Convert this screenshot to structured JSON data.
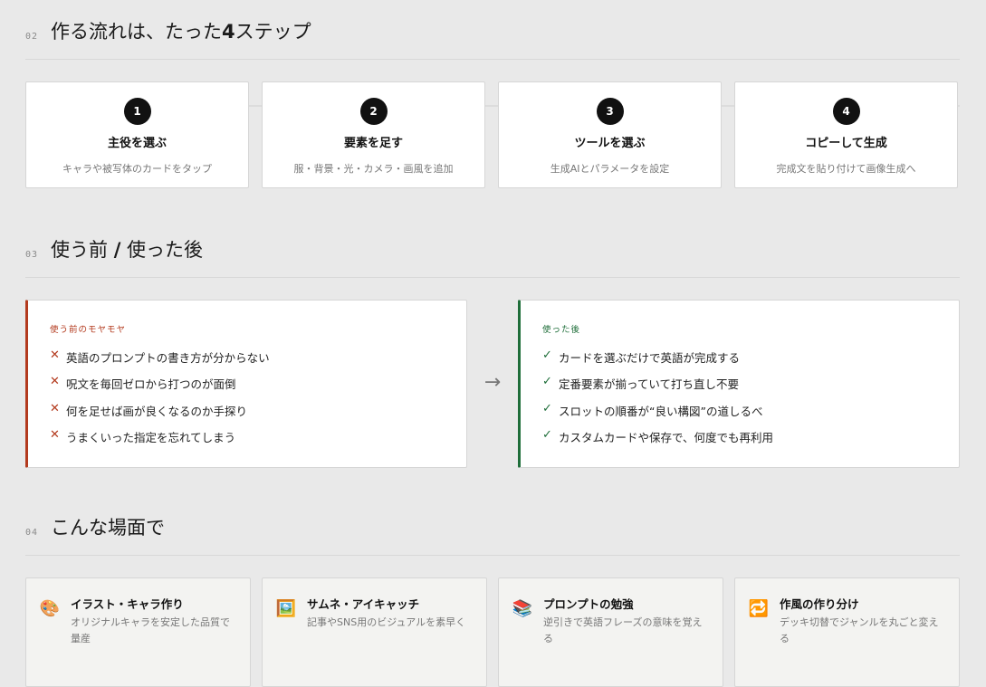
{
  "sections": {
    "steps": {
      "num": "02",
      "title_pre": "作る流れは、たった",
      "title_bold": "4",
      "title_post": "ステップ"
    },
    "before_after": {
      "num": "03",
      "title_pre": "使う前 ",
      "title_bold": "/",
      "title_post": " 使った後"
    },
    "scenes": {
      "num": "04",
      "title": "こんな場面で"
    }
  },
  "steps": [
    {
      "number": "1",
      "title": "主役を選ぶ",
      "desc": "キャラや被写体のカードをタップ"
    },
    {
      "number": "2",
      "title": "要素を足す",
      "desc": "服・背景・光・カメラ・画風を追加"
    },
    {
      "number": "3",
      "title": "ツールを選ぶ",
      "desc": "生成AIとパラメータを設定"
    },
    {
      "number": "4",
      "title": "コピーして生成",
      "desc": "完成文を貼り付けて画像生成へ"
    }
  ],
  "before": {
    "label": "使う前のモヤモヤ",
    "mark": "✕",
    "items": [
      "英語のプロンプトの書き方が分からない",
      "呪文を毎回ゼロから打つのが面倒",
      "何を足せば画が良くなるのか手探り",
      "うまくいった指定を忘れてしまう"
    ]
  },
  "after": {
    "label": "使った後",
    "mark": "✓",
    "items": [
      "カードを選ぶだけで英語が完成する",
      "定番要素が揃っていて打ち直し不要",
      "スロットの順番が“良い構図”の道しるべ",
      "カスタムカードや保存で、何度でも再利用"
    ]
  },
  "arrow": "→",
  "cases": [
    {
      "icon": "🎨",
      "icon_name": "palette-icon",
      "title": "イラスト・キャラ作り",
      "desc": "オリジナルキャラを安定した品質で量産"
    },
    {
      "icon": "🖼️",
      "icon_name": "framed-picture-icon",
      "title": "サムネ・アイキャッチ",
      "desc": "記事やSNS用のビジュアルを素早く"
    },
    {
      "icon": "📚",
      "icon_name": "books-icon",
      "title": "プロンプトの勉強",
      "desc": "逆引きで英語フレーズの意味を覚える"
    },
    {
      "icon": "🔁",
      "icon_name": "repeat-icon",
      "title": "作風の作り分け",
      "desc": "デッキ切替でジャンルを丸ごと変える"
    }
  ]
}
